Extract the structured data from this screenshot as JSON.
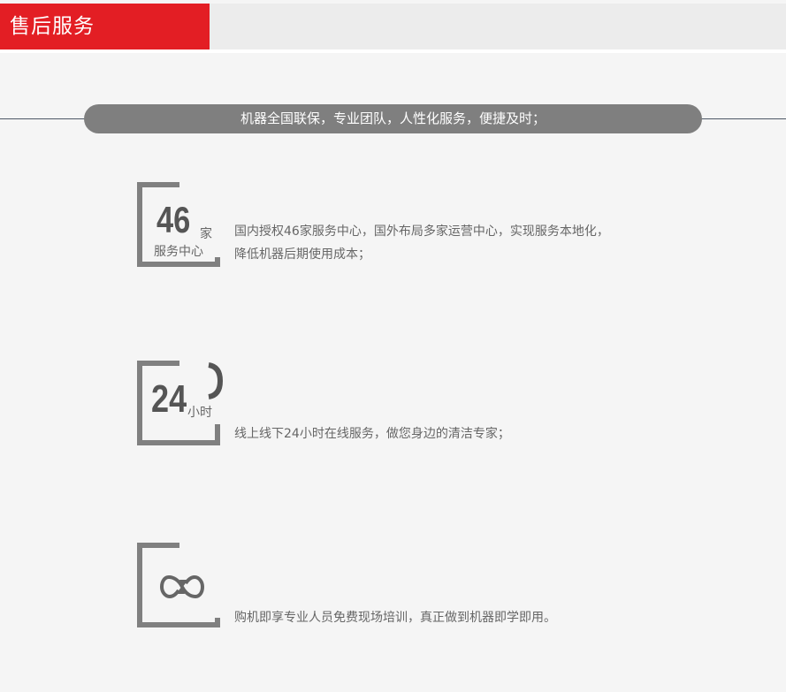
{
  "header": {
    "title": "售后服务"
  },
  "banner": {
    "text": "机器全国联保，专业团队，人性化服务，便捷及时；"
  },
  "features": [
    {
      "number": "46",
      "unit": "家",
      "sublabel": "服务中心",
      "description_lines": [
        "国内授权46家服务中心，国外布局多家运营中心，实现服务本地化，",
        "降低机器后期使用成本；"
      ]
    },
    {
      "number": "24",
      "unit": "小时",
      "icon": "phone-icon",
      "description_lines": [
        "线上线下24小时在线服务，做您身边的清洁专家；"
      ]
    },
    {
      "icon": "cycle-arrows-icon",
      "description_lines": [
        "购机即享专业人员免费现场培训，真正做到机器即学即用。"
      ]
    }
  ],
  "colors": {
    "accent_red": "#e31e24",
    "banner_gray": "#7f7f7f",
    "bracket_gray": "#808080",
    "text_gray": "#666666"
  }
}
